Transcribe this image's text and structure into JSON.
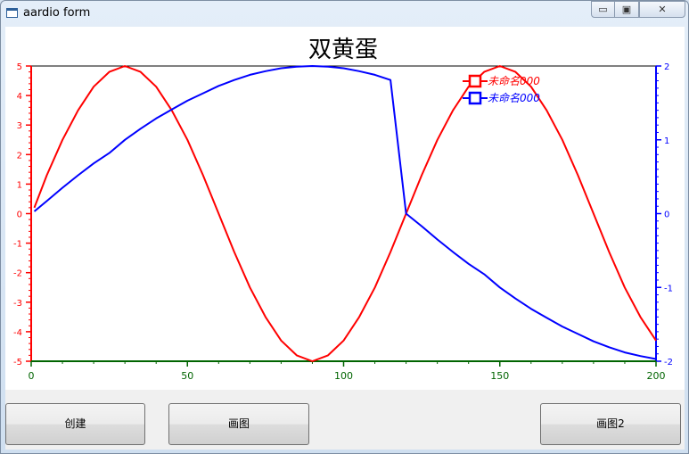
{
  "window": {
    "title": "aardio form",
    "controls": {
      "minimize": "▭",
      "maximize": "▣",
      "close": "✕"
    }
  },
  "buttons": {
    "create": "创建",
    "draw": "画图",
    "draw2": "画图2"
  },
  "colors": {
    "red_series": "#ff0000",
    "blue_series": "#0000ff",
    "x_axis": "#006400"
  },
  "chart_data": {
    "type": "line",
    "title": "双黄蛋",
    "xlim": [
      0,
      200
    ],
    "x_ticks": [
      0,
      50,
      100,
      150,
      200
    ],
    "ylim_left": [
      -5,
      5
    ],
    "y_ticks_left": [
      -5,
      -4,
      -3,
      -2,
      -1,
      0,
      1,
      2,
      3,
      4,
      5
    ],
    "ylim_right": [
      -2,
      2
    ],
    "y_ticks_right": [
      -2,
      -1,
      0,
      1,
      2
    ],
    "grid": false,
    "legend_position": "top-right",
    "series": [
      {
        "name": "未命名000",
        "axis": "left",
        "color": "#ff0000",
        "x": [
          1,
          5,
          10,
          15,
          20,
          25,
          30,
          35,
          40,
          45,
          50,
          55,
          60,
          65,
          70,
          75,
          80,
          85,
          90,
          95,
          100,
          105,
          110,
          115,
          120,
          125,
          130,
          135,
          140,
          145,
          150,
          155,
          160,
          165,
          170,
          175,
          180,
          185,
          190,
          195,
          200
        ],
        "y": [
          0.2,
          1.3,
          2.5,
          3.5,
          4.3,
          4.8,
          5.0,
          4.8,
          4.3,
          3.5,
          2.5,
          1.3,
          0.0,
          -1.3,
          -2.5,
          -3.5,
          -4.3,
          -4.8,
          -5.0,
          -4.8,
          -4.3,
          -3.5,
          -2.5,
          -1.3,
          0.0,
          1.3,
          2.5,
          3.5,
          4.3,
          4.8,
          5.0,
          4.8,
          4.3,
          3.5,
          2.5,
          1.3,
          0.0,
          -1.3,
          -2.5,
          -3.5,
          -4.3
        ]
      },
      {
        "name": "未命名000",
        "axis": "right",
        "color": "#0000ff",
        "x": [
          1,
          5,
          10,
          15,
          20,
          25,
          30,
          35,
          40,
          45,
          50,
          55,
          60,
          65,
          70,
          75,
          80,
          85,
          90,
          95,
          100,
          105,
          110,
          115,
          120,
          125,
          130,
          135,
          140,
          145,
          150,
          155,
          160,
          165,
          170,
          175,
          180,
          185,
          190,
          195,
          200
        ],
        "y": [
          0.03,
          0.17,
          0.35,
          0.52,
          0.68,
          0.82,
          1.0,
          1.15,
          1.29,
          1.41,
          1.53,
          1.63,
          1.73,
          1.81,
          1.88,
          1.93,
          1.97,
          1.99,
          2.0,
          1.99,
          1.97,
          1.93,
          1.88,
          1.81,
          0.0,
          -0.17,
          -0.35,
          -0.52,
          -0.68,
          -0.82,
          -1.0,
          -1.15,
          -1.29,
          -1.41,
          -1.53,
          -1.63,
          -1.73,
          -1.81,
          -1.88,
          -1.93,
          -1.97
        ]
      }
    ]
  }
}
